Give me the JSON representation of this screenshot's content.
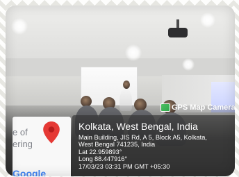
{
  "badge": {
    "label": "GPS Map Camera"
  },
  "location": {
    "title": "Kolkata, West Bengal, India",
    "address_line_1": "Main Building, JIS Rd, A 5, Block A5, Kolkata,",
    "address_line_2": "West Bengal 741235, India",
    "lat": "Lat 22.959893°",
    "long": "Long 88.447916°",
    "timestamp": "17/03/23 03:31 PM GMT +05:30"
  },
  "map": {
    "text_fragment_1": "e of",
    "text_fragment_2": "ering",
    "logo": "Google"
  },
  "icons": {
    "gps": "gps-map-camera-icon",
    "pin": "map-pin-icon"
  },
  "colors": {
    "pin_red": "#e53935",
    "logo_blue": "#4285F4",
    "logo_red": "#EA4335",
    "logo_yellow": "#FBBC05",
    "logo_green": "#34A853"
  }
}
